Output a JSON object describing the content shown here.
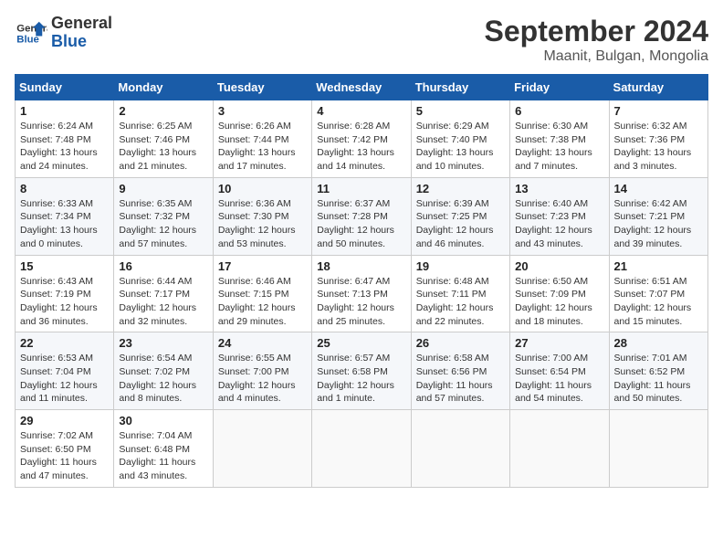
{
  "header": {
    "logo_line1": "General",
    "logo_line2": "Blue",
    "month": "September 2024",
    "location": "Maanit, Bulgan, Mongolia"
  },
  "weekdays": [
    "Sunday",
    "Monday",
    "Tuesday",
    "Wednesday",
    "Thursday",
    "Friday",
    "Saturday"
  ],
  "weeks": [
    [
      {
        "day": "1",
        "info": "Sunrise: 6:24 AM\nSunset: 7:48 PM\nDaylight: 13 hours\nand 24 minutes."
      },
      {
        "day": "2",
        "info": "Sunrise: 6:25 AM\nSunset: 7:46 PM\nDaylight: 13 hours\nand 21 minutes."
      },
      {
        "day": "3",
        "info": "Sunrise: 6:26 AM\nSunset: 7:44 PM\nDaylight: 13 hours\nand 17 minutes."
      },
      {
        "day": "4",
        "info": "Sunrise: 6:28 AM\nSunset: 7:42 PM\nDaylight: 13 hours\nand 14 minutes."
      },
      {
        "day": "5",
        "info": "Sunrise: 6:29 AM\nSunset: 7:40 PM\nDaylight: 13 hours\nand 10 minutes."
      },
      {
        "day": "6",
        "info": "Sunrise: 6:30 AM\nSunset: 7:38 PM\nDaylight: 13 hours\nand 7 minutes."
      },
      {
        "day": "7",
        "info": "Sunrise: 6:32 AM\nSunset: 7:36 PM\nDaylight: 13 hours\nand 3 minutes."
      }
    ],
    [
      {
        "day": "8",
        "info": "Sunrise: 6:33 AM\nSunset: 7:34 PM\nDaylight: 13 hours\nand 0 minutes."
      },
      {
        "day": "9",
        "info": "Sunrise: 6:35 AM\nSunset: 7:32 PM\nDaylight: 12 hours\nand 57 minutes."
      },
      {
        "day": "10",
        "info": "Sunrise: 6:36 AM\nSunset: 7:30 PM\nDaylight: 12 hours\nand 53 minutes."
      },
      {
        "day": "11",
        "info": "Sunrise: 6:37 AM\nSunset: 7:28 PM\nDaylight: 12 hours\nand 50 minutes."
      },
      {
        "day": "12",
        "info": "Sunrise: 6:39 AM\nSunset: 7:25 PM\nDaylight: 12 hours\nand 46 minutes."
      },
      {
        "day": "13",
        "info": "Sunrise: 6:40 AM\nSunset: 7:23 PM\nDaylight: 12 hours\nand 43 minutes."
      },
      {
        "day": "14",
        "info": "Sunrise: 6:42 AM\nSunset: 7:21 PM\nDaylight: 12 hours\nand 39 minutes."
      }
    ],
    [
      {
        "day": "15",
        "info": "Sunrise: 6:43 AM\nSunset: 7:19 PM\nDaylight: 12 hours\nand 36 minutes."
      },
      {
        "day": "16",
        "info": "Sunrise: 6:44 AM\nSunset: 7:17 PM\nDaylight: 12 hours\nand 32 minutes."
      },
      {
        "day": "17",
        "info": "Sunrise: 6:46 AM\nSunset: 7:15 PM\nDaylight: 12 hours\nand 29 minutes."
      },
      {
        "day": "18",
        "info": "Sunrise: 6:47 AM\nSunset: 7:13 PM\nDaylight: 12 hours\nand 25 minutes."
      },
      {
        "day": "19",
        "info": "Sunrise: 6:48 AM\nSunset: 7:11 PM\nDaylight: 12 hours\nand 22 minutes."
      },
      {
        "day": "20",
        "info": "Sunrise: 6:50 AM\nSunset: 7:09 PM\nDaylight: 12 hours\nand 18 minutes."
      },
      {
        "day": "21",
        "info": "Sunrise: 6:51 AM\nSunset: 7:07 PM\nDaylight: 12 hours\nand 15 minutes."
      }
    ],
    [
      {
        "day": "22",
        "info": "Sunrise: 6:53 AM\nSunset: 7:04 PM\nDaylight: 12 hours\nand 11 minutes."
      },
      {
        "day": "23",
        "info": "Sunrise: 6:54 AM\nSunset: 7:02 PM\nDaylight: 12 hours\nand 8 minutes."
      },
      {
        "day": "24",
        "info": "Sunrise: 6:55 AM\nSunset: 7:00 PM\nDaylight: 12 hours\nand 4 minutes."
      },
      {
        "day": "25",
        "info": "Sunrise: 6:57 AM\nSunset: 6:58 PM\nDaylight: 12 hours\nand 1 minute."
      },
      {
        "day": "26",
        "info": "Sunrise: 6:58 AM\nSunset: 6:56 PM\nDaylight: 11 hours\nand 57 minutes."
      },
      {
        "day": "27",
        "info": "Sunrise: 7:00 AM\nSunset: 6:54 PM\nDaylight: 11 hours\nand 54 minutes."
      },
      {
        "day": "28",
        "info": "Sunrise: 7:01 AM\nSunset: 6:52 PM\nDaylight: 11 hours\nand 50 minutes."
      }
    ],
    [
      {
        "day": "29",
        "info": "Sunrise: 7:02 AM\nSunset: 6:50 PM\nDaylight: 11 hours\nand 47 minutes."
      },
      {
        "day": "30",
        "info": "Sunrise: 7:04 AM\nSunset: 6:48 PM\nDaylight: 11 hours\nand 43 minutes."
      },
      {
        "day": "",
        "info": ""
      },
      {
        "day": "",
        "info": ""
      },
      {
        "day": "",
        "info": ""
      },
      {
        "day": "",
        "info": ""
      },
      {
        "day": "",
        "info": ""
      }
    ]
  ]
}
